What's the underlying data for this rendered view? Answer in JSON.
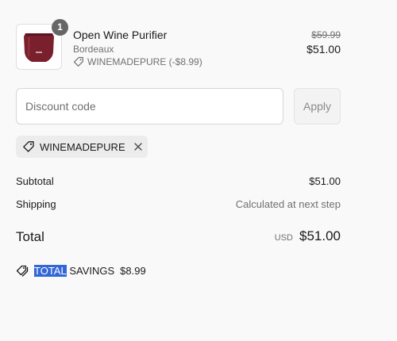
{
  "line_item": {
    "quantity": "1",
    "name": "Open Wine Purifier",
    "variant": "Bordeaux",
    "discount_label": "WINEMADEPURE (-$8.99)",
    "compare_price": "$59.99",
    "price": "$51.00",
    "product_color": "#7a1f2c",
    "icons": [
      "product-thumbnail",
      "tag-icon"
    ]
  },
  "discount": {
    "placeholder": "Discount code",
    "apply_label": "Apply",
    "applied_code": "WINEMADEPURE",
    "icons": [
      "tag-icon",
      "close-icon"
    ]
  },
  "summary": {
    "subtotal_label": "Subtotal",
    "subtotal_value": "$51.00",
    "shipping_label": "Shipping",
    "shipping_value": "Calculated at next step",
    "total_label": "Total",
    "currency": "USD",
    "total_value": "$51.00"
  },
  "savings": {
    "label_highlighted": "TOTAL",
    "label_rest": " SAVINGS",
    "amount": "$8.99",
    "highlight_color": "#3367d6",
    "icon": "tags-icon"
  }
}
